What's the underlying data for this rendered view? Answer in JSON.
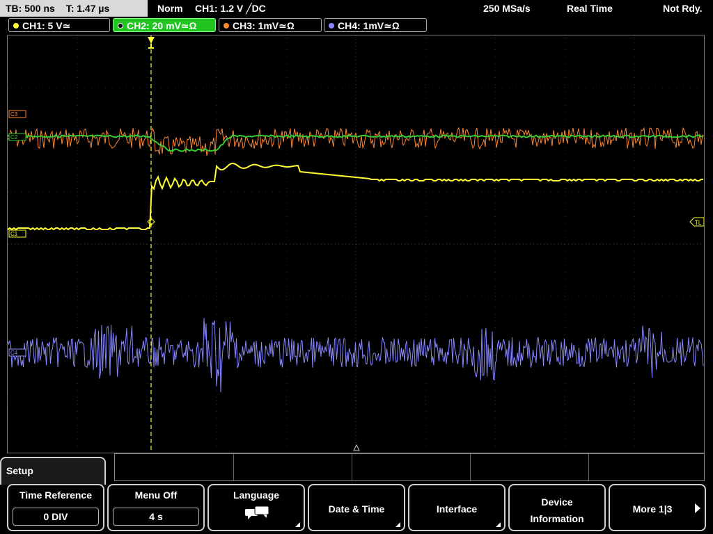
{
  "status": {
    "timebase": "TB: 500 ns",
    "trigger_time": "T: 1.47 µs",
    "mode": "Norm",
    "trigger": "CH1: 1.2 V ╱DC",
    "sample_rate": "250 MSa/s",
    "acq_mode": "Real Time",
    "state": "Not Rdy."
  },
  "channels": [
    {
      "label": "CH1: 5 V≃",
      "color": "#ffff33"
    },
    {
      "label": "CH2: 20 mV≃Ω",
      "color": "#33cc33"
    },
    {
      "label": "CH3: 1mV≃Ω",
      "color": "#ff8833"
    },
    {
      "label": "CH4: 1mV≃Ω",
      "color": "#8888ff"
    }
  ],
  "markers": {
    "c3": "C3",
    "c2": "C2",
    "c1": "C1",
    "c4": "C4",
    "trigger_level": "TL"
  },
  "menu": {
    "title": "Setup",
    "softkeys": [
      {
        "label": "Time Reference",
        "value": "0 DIV"
      },
      {
        "label": "Menu Off",
        "value": "4 s"
      },
      {
        "label": "Language",
        "icon": "speech-bubbles-icon"
      },
      {
        "label": "Date & Time"
      },
      {
        "label": "Interface"
      },
      {
        "label": "Device Information"
      },
      {
        "label": "More 1|3"
      }
    ]
  }
}
